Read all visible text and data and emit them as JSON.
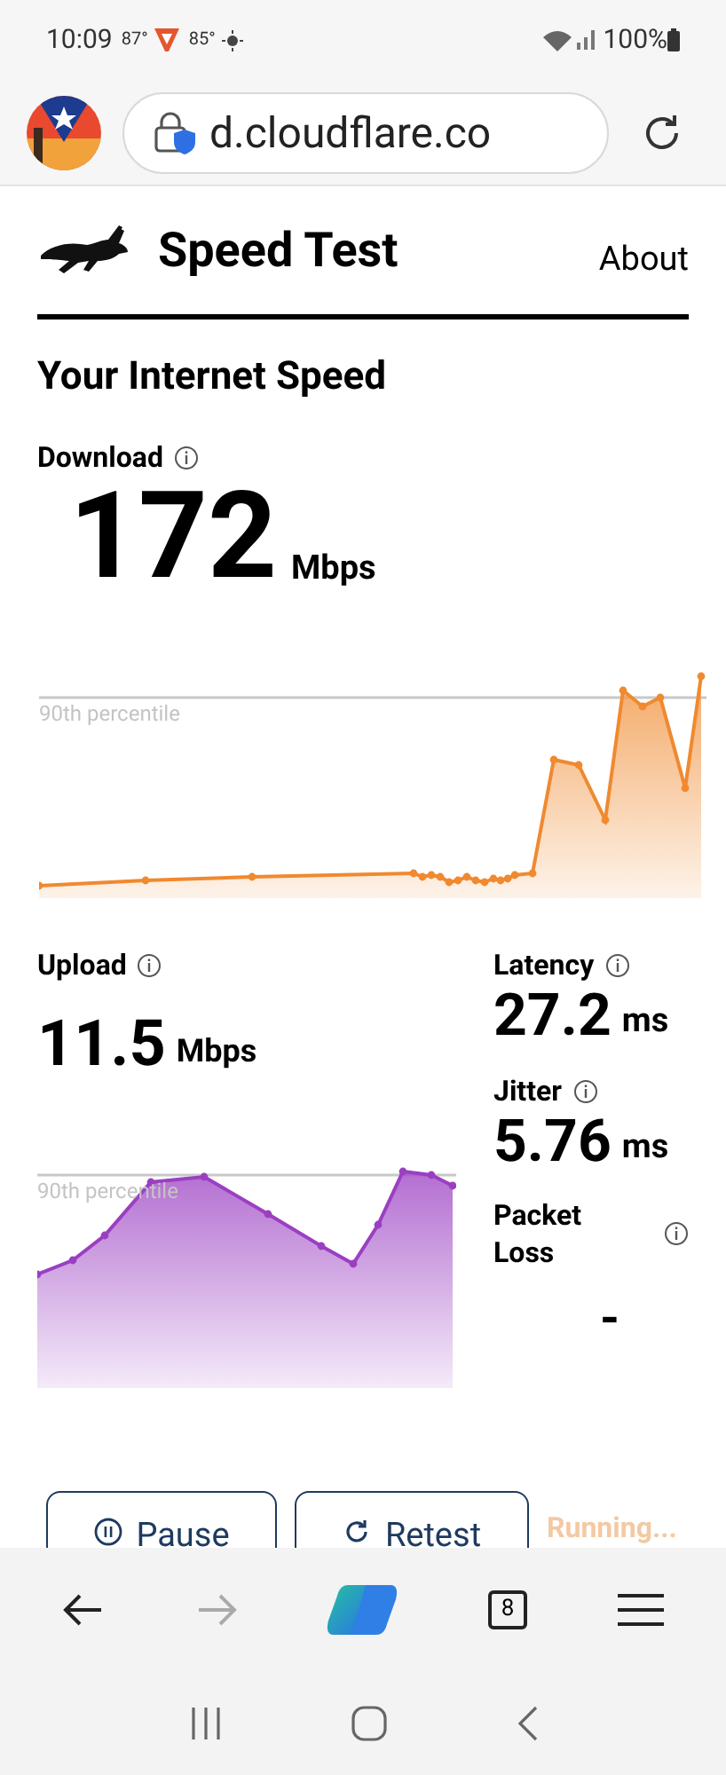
{
  "status_bar": {
    "time": "10:09",
    "temp_1": "87°",
    "temp_2": "85°",
    "battery": "100%"
  },
  "browser": {
    "url": "d.cloudflare.co",
    "tab_count": "8"
  },
  "header": {
    "title": "Speed Test",
    "nav_link": "About"
  },
  "heading": "Your Internet Speed",
  "download": {
    "label": "Download",
    "value": "172",
    "unit": "Mbps",
    "percentile_label": "90th percentile"
  },
  "upload": {
    "label": "Upload",
    "value": "11.5",
    "unit": "Mbps",
    "percentile_label": "90th percentile"
  },
  "metrics": [
    {
      "label": "Latency",
      "value": "27.2",
      "unit": "ms"
    },
    {
      "label": "Jitter",
      "value": "5.76",
      "unit": "ms"
    }
  ],
  "packet_loss": {
    "label": "Packet Loss",
    "value": "-"
  },
  "buttons": [
    {
      "label": "Pause",
      "kind": "pause"
    },
    {
      "label": "Retest",
      "kind": "retest"
    }
  ],
  "run_status": "Running..."
}
